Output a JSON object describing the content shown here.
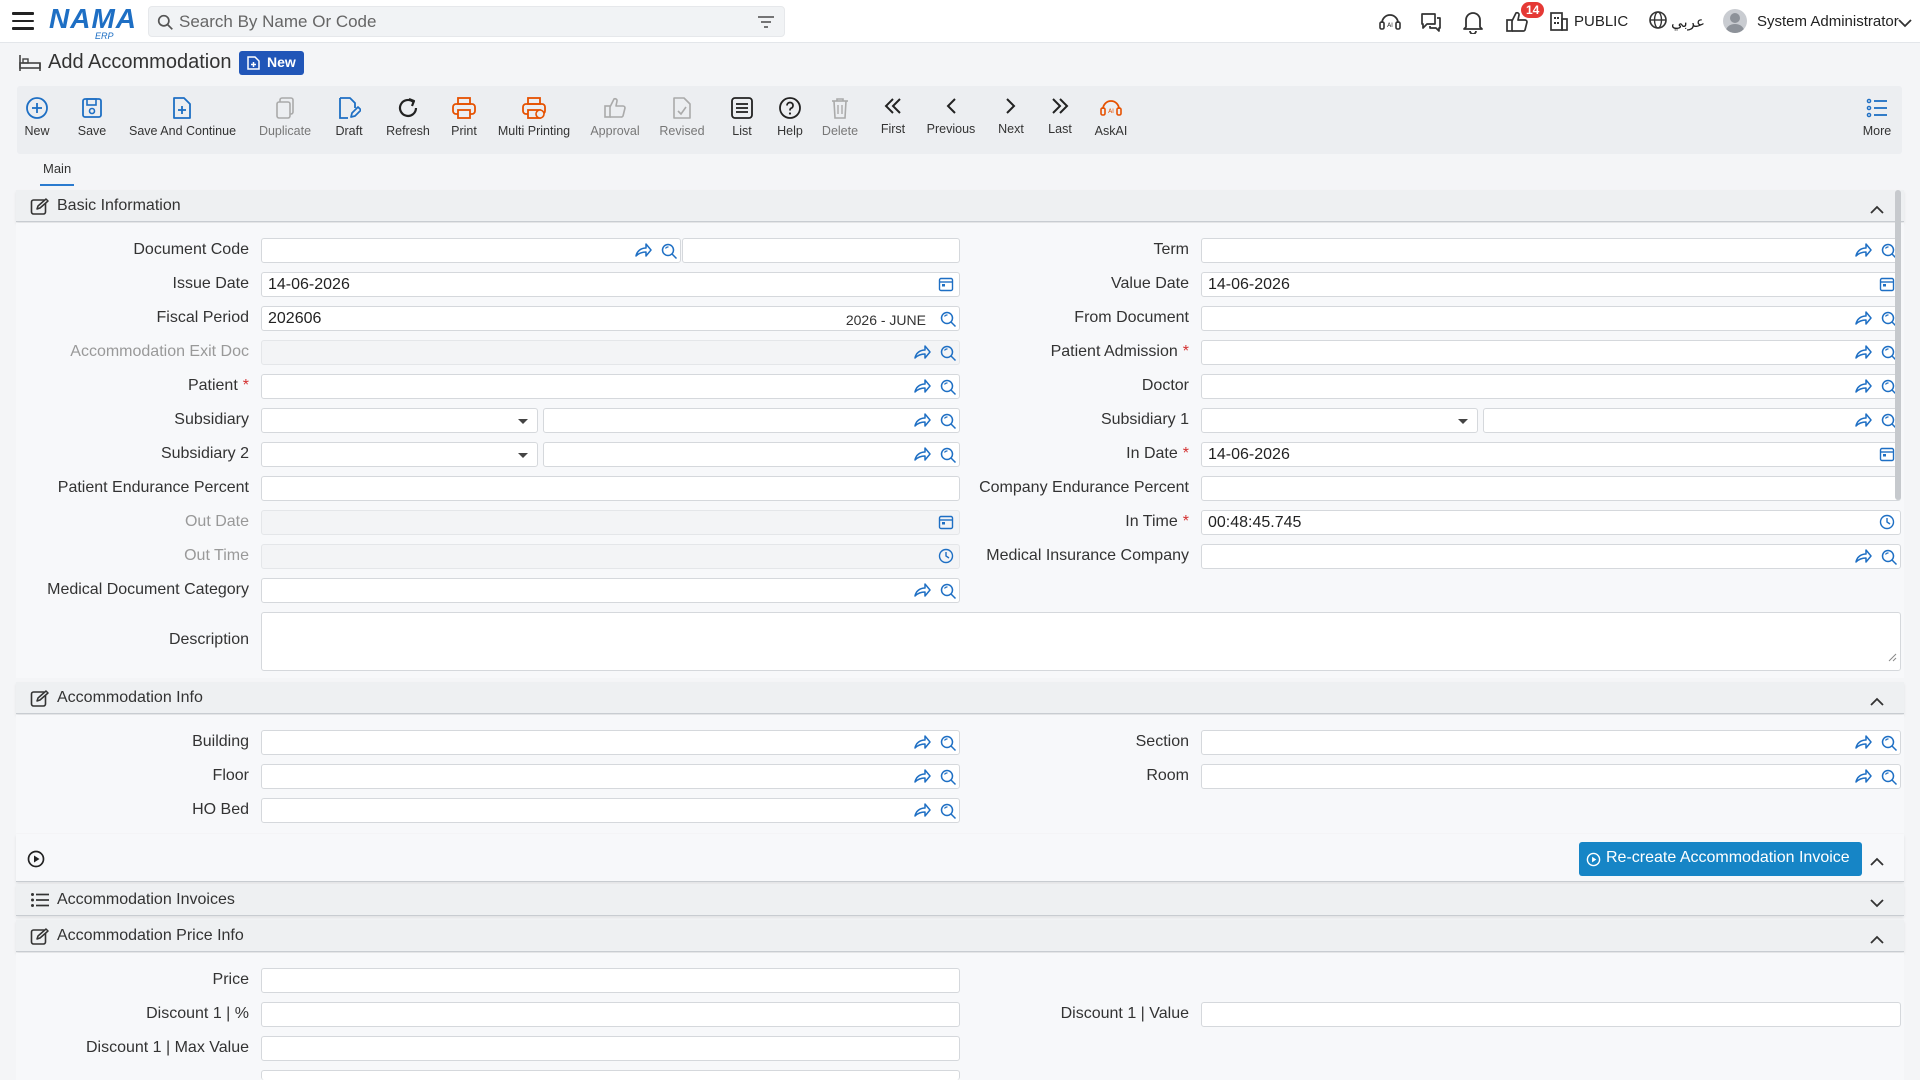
{
  "topbar": {
    "logo": "NAMA",
    "logo_sub": "ERP",
    "search_placeholder": "Search By Name Or Code",
    "notification_count": "14",
    "public_label": "PUBLIC",
    "language_label": "عربي",
    "user_name": "System Administrator"
  },
  "page": {
    "title": "Add Accommodation",
    "badge": "New"
  },
  "toolbar": [
    {
      "label": "New",
      "icon": "plus-circle-icon",
      "color": "#1e6fc4"
    },
    {
      "label": "Save",
      "icon": "save-icon",
      "color": "#1e6fc4"
    },
    {
      "label": "Save And Continue",
      "icon": "file-plus-icon",
      "color": "#1e6fc4"
    },
    {
      "label": "Duplicate",
      "icon": "copy-icon",
      "color": "#aaaaaa"
    },
    {
      "label": "Draft",
      "icon": "edit-file-icon",
      "color": "#1e6fc4"
    },
    {
      "label": "Refresh",
      "icon": "refresh-icon",
      "color": "#222222"
    },
    {
      "label": "Print",
      "icon": "printer-icon",
      "color": "#e65100"
    },
    {
      "label": "Multi Printing",
      "icon": "multi-printer-icon",
      "color": "#e65100"
    },
    {
      "label": "Approval",
      "icon": "thumbs-up-icon",
      "color": "#aaaaaa"
    },
    {
      "label": "Revised",
      "icon": "revised-file-icon",
      "color": "#aaaaaa"
    },
    {
      "label": "List",
      "icon": "list-icon",
      "color": "#222222"
    },
    {
      "label": "Help",
      "icon": "help-icon",
      "color": "#222222"
    },
    {
      "label": "Delete",
      "icon": "trash-icon",
      "color": "#aaaaaa"
    },
    {
      "label": "First",
      "icon": "double-chevron-left-icon",
      "color": "#222222"
    },
    {
      "label": "Previous",
      "icon": "chevron-left-icon",
      "color": "#222222"
    },
    {
      "label": "Next",
      "icon": "chevron-right-icon",
      "color": "#222222"
    },
    {
      "label": "Last",
      "icon": "double-chevron-right-icon",
      "color": "#222222"
    },
    {
      "label": "AskAI",
      "icon": "ai-icon",
      "color": "#e65100"
    },
    {
      "label": "More",
      "icon": "more-list-icon",
      "color": "#1e6fc4"
    }
  ],
  "tabs": {
    "main": "Main"
  },
  "sections": {
    "basic": "Basic Information",
    "accommodation": "Accommodation Info",
    "invoices": "Accommodation Invoices",
    "price": "Accommodation Price Info"
  },
  "basic": {
    "document_code": "Document Code",
    "issue_date": "Issue Date",
    "issue_date_value": "14-06-2026",
    "fiscal_period": "Fiscal Period",
    "fiscal_period_value": "202606",
    "fiscal_period_hint": "2026 - JUNE",
    "accommodation_exit_doc": "Accommodation Exit Doc",
    "patient": "Patient",
    "subsidiary": "Subsidiary",
    "subsidiary_2": "Subsidiary 2",
    "patient_endurance_percent": "Patient Endurance Percent",
    "out_date": "Out Date",
    "out_time": "Out Time",
    "medical_document_category": "Medical Document Category",
    "description": "Description",
    "term": "Term",
    "value_date": "Value Date",
    "value_date_value": "14-06-2026",
    "from_document": "From Document",
    "patient_admission": "Patient Admission",
    "doctor": "Doctor",
    "subsidiary_1": "Subsidiary 1",
    "in_date": "In Date",
    "in_date_value": "14-06-2026",
    "company_endurance_percent": "Company Endurance Percent",
    "in_time": "In Time",
    "in_time_value": "00:48:45.745",
    "medical_insurance_company": "Medical Insurance Company",
    "required_mark": "*"
  },
  "accommodation": {
    "building": "Building",
    "floor": "Floor",
    "ho_bed": "HO Bed",
    "section": "Section",
    "room": "Room"
  },
  "actions": {
    "recreate_invoice": "Re-create Accommodation Invoice"
  },
  "price": {
    "price": "Price",
    "discount1_percent": "Discount 1 | %",
    "discount1_max_value": "Discount 1 | Max Value",
    "discount1_value": "Discount 1 | Value"
  }
}
